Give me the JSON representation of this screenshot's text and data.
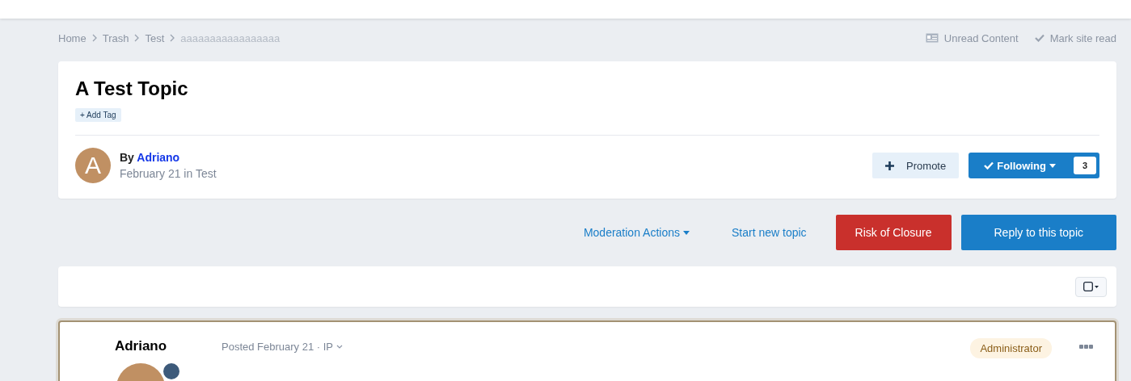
{
  "breadcrumb": [
    "Home",
    "Trash",
    "Test",
    "aaaaaaaaaaaaaaaaa"
  ],
  "header_links": [
    {
      "kind": "unread",
      "label": "Unread Content"
    },
    {
      "kind": "mark",
      "label": "Mark site read"
    }
  ],
  "topic": {
    "title": "A Test Topic",
    "add_tag": "+ Add Tag",
    "avatar_letter": "A",
    "by": "By",
    "author": "Adriano",
    "meta": "February 21 in Test",
    "promote": "Promote",
    "following": "Following",
    "follower_count": "3"
  },
  "actions": [
    {
      "kind": "menu",
      "label": "Moderation Actions"
    },
    {
      "kind": "link",
      "label": "Start new topic"
    },
    {
      "kind": "danger",
      "label": "Risk of Closure"
    },
    {
      "kind": "primary",
      "label": "Reply to this topic"
    }
  ],
  "post": {
    "author": "Adriano",
    "posted": "Posted February 21 · IP",
    "role": "Administrator"
  }
}
